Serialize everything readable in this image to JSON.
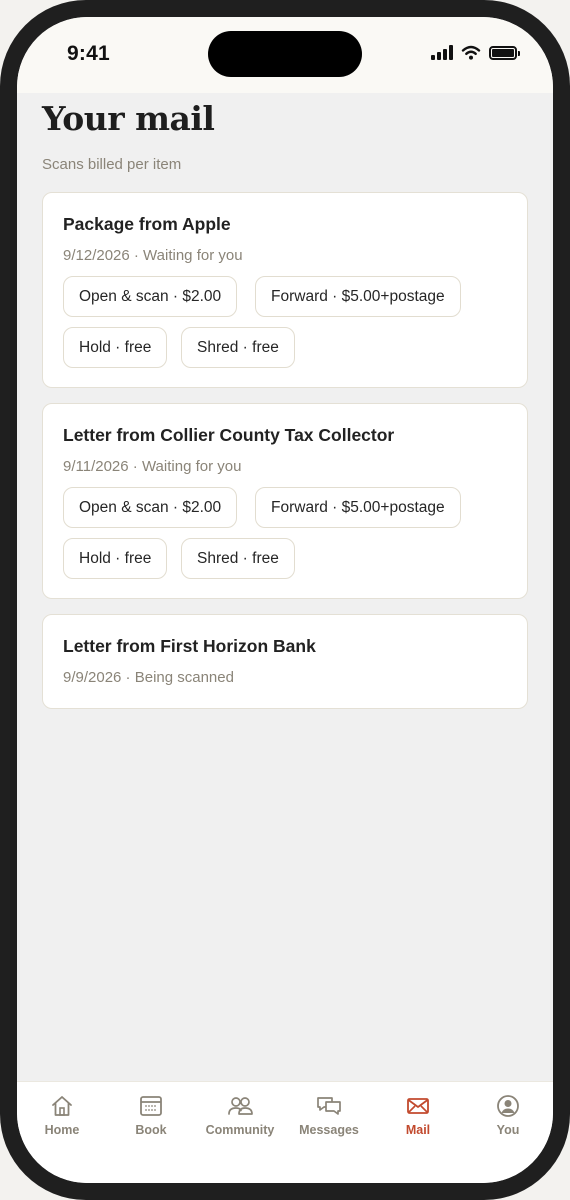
{
  "status": {
    "time": "9:41"
  },
  "header": {
    "title": "Your mail",
    "subtitle": "Scans billed per item"
  },
  "mail_items": [
    {
      "title": "Package from Apple",
      "date": "9/12/2026",
      "status": "Waiting for you",
      "meta": "9/12/2026 · Waiting for you",
      "actions": [
        "Open & scan · $2.00",
        "Forward · $5.00+postage",
        "Hold · free",
        "Shred · free"
      ]
    },
    {
      "title": "Letter from Collier County Tax Collector",
      "date": "9/11/2026",
      "status": "Waiting for you",
      "meta": "9/11/2026 · Waiting for you",
      "actions": [
        "Open & scan · $2.00",
        "Forward · $5.00+postage",
        "Hold · free",
        "Shred · free"
      ]
    },
    {
      "title": "Letter from First Horizon Bank",
      "date": "9/9/2026",
      "status": "Being scanned",
      "meta": "9/9/2026 · Being scanned",
      "actions": []
    }
  ],
  "tabbar": {
    "active": "Mail",
    "accent_color": "#c24a2e",
    "items": [
      {
        "label": "Home",
        "icon": "home-icon"
      },
      {
        "label": "Book",
        "icon": "calendar-icon"
      },
      {
        "label": "Community",
        "icon": "people-icon"
      },
      {
        "label": "Messages",
        "icon": "chat-bubbles-icon"
      },
      {
        "label": "Mail",
        "icon": "envelope-icon"
      },
      {
        "label": "You",
        "icon": "user-circle-icon"
      }
    ]
  }
}
